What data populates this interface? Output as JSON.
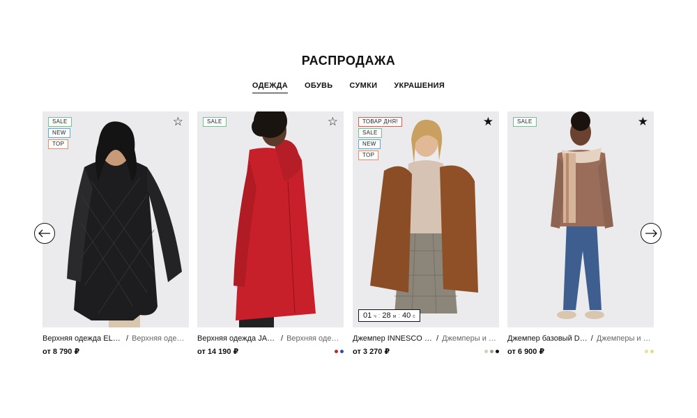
{
  "page": {
    "title": "РАСПРОДАЖА"
  },
  "tabs": [
    {
      "label": "ОДЕЖДА",
      "active": true
    },
    {
      "label": "ОБУВЬ",
      "active": false
    },
    {
      "label": "СУМКИ",
      "active": false
    },
    {
      "label": "УКРАШЕНИЯ",
      "active": false
    }
  ],
  "products": [
    {
      "badges": [
        "SALE",
        "NEW",
        "TOP"
      ],
      "favorite": false,
      "name": "Верхняя одежда ELes…",
      "category": "Верхняя одежда",
      "price": "от 8 790 ₽",
      "colors": [],
      "photo": "woman-black-quilted-coat-photo"
    },
    {
      "badges": [
        "SALE"
      ],
      "favorite": false,
      "name": "Верхняя одежда JAM…",
      "category": "Верхняя одежда",
      "price": "от 14 190 ₽",
      "colors": [
        "#c62828",
        "#3949ab"
      ],
      "photo": "woman-red-parka-photo"
    },
    {
      "badges": [
        "ТОВАР ДНЯ!",
        "SALE",
        "NEW",
        "TOP"
      ],
      "favorite": true,
      "name": "Джемпер INNESCO И…",
      "category": "Джемперы и ка…",
      "price": "от 3 270 ₽",
      "colors": [
        "#d9cdb0",
        "#9e9e9e",
        "#111111"
      ],
      "photo": "woman-brown-jacket-plaid-skirt-photo",
      "timer": {
        "hours": "01",
        "h_unit": "ч",
        "minutes": "28",
        "m_unit": "м",
        "seconds": "40",
        "s_unit": "с"
      }
    },
    {
      "badges": [
        "SALE"
      ],
      "favorite": true,
      "name": "Джемпер базовый D…",
      "category": "Джемперы и ка…",
      "price": "от 6 900 ₽",
      "colors": [
        "#e8e29a",
        "#e3dc8a"
      ],
      "photo": "woman-brown-sweater-scarf-jeans-photo"
    }
  ],
  "badge_colors": {
    "SALE": "#6cc58a",
    "NEW": "#5aa9e6",
    "TOP": "#ef8a62",
    "ТОВАР ДНЯ!": "#e15b4b"
  },
  "icons": {
    "prev": "arrow-left-icon",
    "next": "arrow-right-icon",
    "fav_empty": "star-outline-icon",
    "fav_full": "star-filled-icon"
  }
}
